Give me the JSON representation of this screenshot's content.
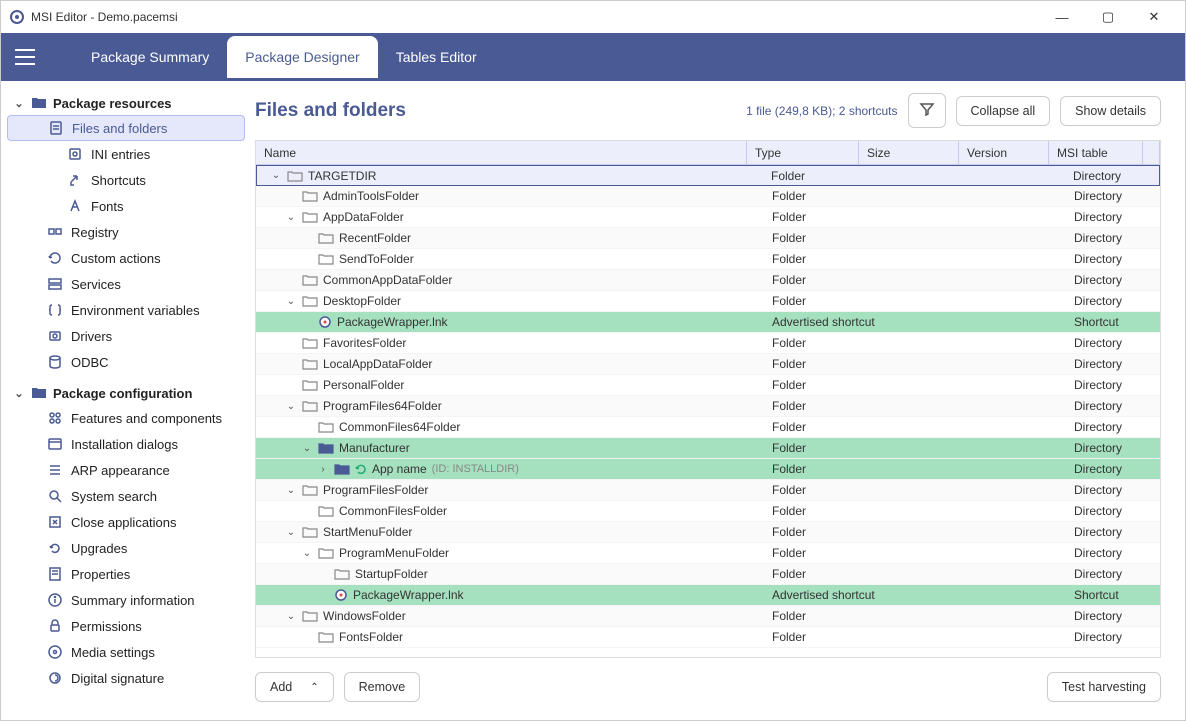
{
  "window": {
    "title": "MSI Editor - Demo.pacemsi"
  },
  "tabs": {
    "summary": "Package Summary",
    "designer": "Package Designer",
    "tables": "Tables Editor"
  },
  "sidebar": {
    "resources": {
      "label": "Package resources",
      "files": "Files and folders",
      "ini": "INI entries",
      "shortcuts": "Shortcuts",
      "fonts": "Fonts",
      "registry": "Registry",
      "custom": "Custom actions",
      "services": "Services",
      "envvars": "Environment variables",
      "drivers": "Drivers",
      "odbc": "ODBC"
    },
    "config": {
      "label": "Package configuration",
      "features": "Features and components",
      "dialogs": "Installation dialogs",
      "arp": "ARP appearance",
      "search": "System search",
      "close": "Close applications",
      "upgrades": "Upgrades",
      "properties": "Properties",
      "summary": "Summary information",
      "permissions": "Permissions",
      "media": "Media settings",
      "signature": "Digital signature"
    }
  },
  "page": {
    "title": "Files and folders",
    "stats": "1 file (249,8 KB); 2 shortcuts",
    "collapse": "Collapse all",
    "details": "Show details"
  },
  "columns": {
    "name": "Name",
    "type": "Type",
    "size": "Size",
    "version": "Version",
    "msi": "MSI table"
  },
  "rows": [
    {
      "name": "TARGETDIR",
      "type": "Folder",
      "msi": "Directory",
      "indent": 0,
      "chev": "down",
      "sel": true
    },
    {
      "name": "AdminToolsFolder",
      "type": "Folder",
      "msi": "Directory",
      "indent": 1
    },
    {
      "name": "AppDataFolder",
      "type": "Folder",
      "msi": "Directory",
      "indent": 1,
      "chev": "down"
    },
    {
      "name": "RecentFolder",
      "type": "Folder",
      "msi": "Directory",
      "indent": 2
    },
    {
      "name": "SendToFolder",
      "type": "Folder",
      "msi": "Directory",
      "indent": 2
    },
    {
      "name": "CommonAppDataFolder",
      "type": "Folder",
      "msi": "Directory",
      "indent": 1
    },
    {
      "name": "DesktopFolder",
      "type": "Folder",
      "msi": "Directory",
      "indent": 1,
      "chev": "down"
    },
    {
      "name": "PackageWrapper.lnk",
      "type": "Advertised shortcut",
      "msi": "Shortcut",
      "indent": 2,
      "green": true,
      "icon": "shortcut"
    },
    {
      "name": "FavoritesFolder",
      "type": "Folder",
      "msi": "Directory",
      "indent": 1
    },
    {
      "name": "LocalAppDataFolder",
      "type": "Folder",
      "msi": "Directory",
      "indent": 1
    },
    {
      "name": "PersonalFolder",
      "type": "Folder",
      "msi": "Directory",
      "indent": 1
    },
    {
      "name": "ProgramFiles64Folder",
      "type": "Folder",
      "msi": "Directory",
      "indent": 1,
      "chev": "down"
    },
    {
      "name": "CommonFiles64Folder",
      "type": "Folder",
      "msi": "Directory",
      "indent": 2
    },
    {
      "name": "Manufacturer",
      "type": "Folder",
      "msi": "Directory",
      "indent": 2,
      "chev": "down",
      "green": true,
      "folderStyle": "blue-solid"
    },
    {
      "name": "App name",
      "suffix": "(ID: INSTALLDIR)",
      "type": "Folder",
      "msi": "Directory",
      "indent": 3,
      "chev": "right",
      "green": true,
      "folderStyle": "blue-solid",
      "refresh": true
    },
    {
      "name": "ProgramFilesFolder",
      "type": "Folder",
      "msi": "Directory",
      "indent": 1,
      "chev": "down"
    },
    {
      "name": "CommonFilesFolder",
      "type": "Folder",
      "msi": "Directory",
      "indent": 2
    },
    {
      "name": "StartMenuFolder",
      "type": "Folder",
      "msi": "Directory",
      "indent": 1,
      "chev": "down"
    },
    {
      "name": "ProgramMenuFolder",
      "type": "Folder",
      "msi": "Directory",
      "indent": 2,
      "chev": "down"
    },
    {
      "name": "StartupFolder",
      "type": "Folder",
      "msi": "Directory",
      "indent": 3
    },
    {
      "name": "PackageWrapper.lnk",
      "type": "Advertised shortcut",
      "msi": "Shortcut",
      "indent": 3,
      "green": true,
      "icon": "shortcut"
    },
    {
      "name": "WindowsFolder",
      "type": "Folder",
      "msi": "Directory",
      "indent": 1,
      "chev": "down"
    },
    {
      "name": "FontsFolder",
      "type": "Folder",
      "msi": "Directory",
      "indent": 2
    }
  ],
  "footer": {
    "add": "Add",
    "remove": "Remove",
    "test": "Test harvesting"
  }
}
